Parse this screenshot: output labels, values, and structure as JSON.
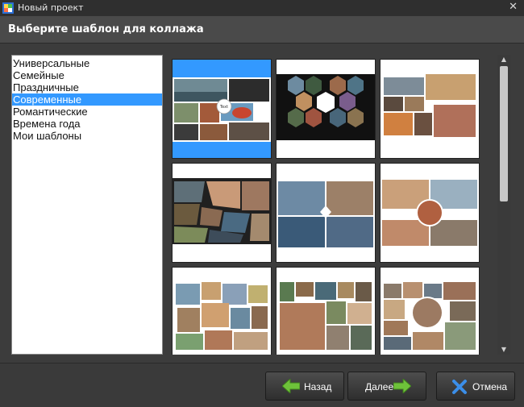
{
  "window": {
    "title": "Новый проект",
    "close_glyph": "✕"
  },
  "heading": "Выберите шаблон для коллажа",
  "categories": [
    {
      "label": "Универсальные",
      "selected": false
    },
    {
      "label": "Семейные",
      "selected": false
    },
    {
      "label": "Праздничные",
      "selected": false
    },
    {
      "label": "Современные",
      "selected": true
    },
    {
      "label": "Романтические",
      "selected": false
    },
    {
      "label": "Времена года",
      "selected": false
    },
    {
      "label": "Мои шаблоны",
      "selected": false
    }
  ],
  "templates": [
    {
      "name": "collage-template-1",
      "selected": true,
      "caption": "Text"
    },
    {
      "name": "collage-template-2",
      "selected": false,
      "caption": ""
    },
    {
      "name": "collage-template-3",
      "selected": false,
      "caption": ""
    },
    {
      "name": "collage-template-4",
      "selected": false,
      "caption": ""
    },
    {
      "name": "collage-template-5",
      "selected": false,
      "caption": ""
    },
    {
      "name": "collage-template-6",
      "selected": false,
      "caption": ""
    },
    {
      "name": "collage-template-7",
      "selected": false,
      "caption": ""
    },
    {
      "name": "collage-template-8",
      "selected": false,
      "caption": ""
    },
    {
      "name": "collage-template-9",
      "selected": false,
      "caption": ""
    }
  ],
  "buttons": {
    "back": "Назад",
    "next": "Далее",
    "cancel": "Отмена"
  },
  "colors": {
    "selection": "#3399ff",
    "arrow": "#6ec23a",
    "cancel_icon": "#3b8ee8"
  }
}
